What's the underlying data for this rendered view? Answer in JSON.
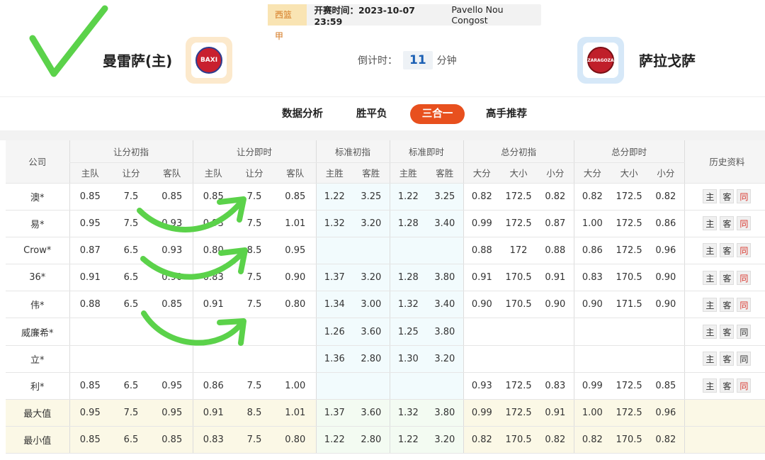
{
  "match": {
    "league": "西篮甲",
    "kickoff": "开赛时间：2023-10-07 23:59",
    "venue": "Pavello Nou Congost",
    "home_team": "曼雷萨(主)",
    "away_team": "萨拉戈萨",
    "home_logo_text": "BAXI",
    "away_logo_text": "ZARAGOZA",
    "countdown_label": "倒计时：",
    "countdown_value": "11",
    "countdown_unit": "分钟"
  },
  "tabs": [
    "数据分析",
    "胜平负",
    "三合一",
    "高手推荐"
  ],
  "active_tab": "三合一",
  "table": {
    "groups": [
      "公司",
      "让分初指",
      "让分即时",
      "标准初指",
      "标准即时",
      "总分初指",
      "总分即时",
      "历史资料"
    ],
    "subheaders": [
      "主队",
      "让分",
      "客队",
      "主队",
      "让分",
      "客队",
      "主胜",
      "客胜",
      "主胜",
      "客胜",
      "大分",
      "大小",
      "小分",
      "大分",
      "大小",
      "小分"
    ],
    "history_buttons": [
      "主",
      "客",
      "同"
    ],
    "rows": [
      {
        "company": "澳*",
        "cells": [
          "0.85",
          "7.5",
          "0.85",
          "0.85",
          "7.5",
          "0.85",
          "1.22",
          "3.25",
          "1.22",
          "3.25",
          "0.82",
          "172.5",
          "0.82",
          "0.82",
          "172.5",
          "0.82"
        ],
        "same_red": true
      },
      {
        "company": "易*",
        "cells": [
          "0.95",
          "7.5",
          "0.93",
          "0.93",
          "7.5",
          "1.01",
          "1.32",
          "3.20",
          "1.28",
          "3.40",
          "0.99",
          "172.5",
          "0.87",
          "1.00",
          "172.5",
          "0.86"
        ],
        "same_red": true
      },
      {
        "company": "Crow*",
        "cells": [
          "0.87",
          "6.5",
          "0.93",
          "0.80",
          "8.5",
          "0.95",
          "",
          "",
          "",
          "",
          "0.88",
          "172",
          "0.88",
          "0.86",
          "172.5",
          "0.96"
        ],
        "same_red": true
      },
      {
        "company": "36*",
        "cells": [
          "0.91",
          "6.5",
          "0.90",
          "0.83",
          "7.5",
          "0.90",
          "1.37",
          "3.20",
          "1.28",
          "3.80",
          "0.91",
          "170.5",
          "0.91",
          "0.83",
          "170.5",
          "0.90"
        ],
        "same_red": true
      },
      {
        "company": "伟*",
        "cells": [
          "0.88",
          "6.5",
          "0.85",
          "0.91",
          "7.5",
          "0.80",
          "1.34",
          "3.00",
          "1.32",
          "3.40",
          "0.90",
          "170.5",
          "0.90",
          "0.90",
          "171.5",
          "0.90"
        ],
        "same_red": true
      },
      {
        "company": "威廉希*",
        "cells": [
          "",
          "",
          "",
          "",
          "",
          "",
          "1.26",
          "3.60",
          "1.25",
          "3.80",
          "",
          "",
          "",
          "",
          "",
          ""
        ],
        "same_red": false
      },
      {
        "company": "立*",
        "cells": [
          "",
          "",
          "",
          "",
          "",
          "",
          "1.36",
          "2.80",
          "1.30",
          "3.20",
          "",
          "",
          "",
          "",
          "",
          ""
        ],
        "same_red": false
      },
      {
        "company": "利*",
        "cells": [
          "0.85",
          "6.5",
          "0.95",
          "0.86",
          "7.5",
          "1.00",
          "",
          "",
          "",
          "",
          "0.93",
          "172.5",
          "0.83",
          "0.99",
          "172.5",
          "0.85"
        ],
        "same_red": true
      },
      {
        "company": "最大值",
        "cells": [
          "0.95",
          "7.5",
          "0.95",
          "0.91",
          "8.5",
          "1.01",
          "1.37",
          "3.60",
          "1.32",
          "3.80",
          "0.99",
          "172.5",
          "0.91",
          "1.00",
          "172.5",
          "0.96"
        ],
        "same_red": false,
        "extreme": true
      },
      {
        "company": "最小值",
        "cells": [
          "0.85",
          "6.5",
          "0.85",
          "0.83",
          "7.5",
          "0.80",
          "1.22",
          "2.80",
          "1.22",
          "3.20",
          "0.82",
          "170.5",
          "0.82",
          "0.82",
          "170.5",
          "0.82"
        ],
        "same_red": false,
        "extreme": true
      }
    ]
  },
  "colors": {
    "accent": "#e8501e",
    "live_value": "#1f5fa8",
    "annotation": "#5bd24a"
  }
}
